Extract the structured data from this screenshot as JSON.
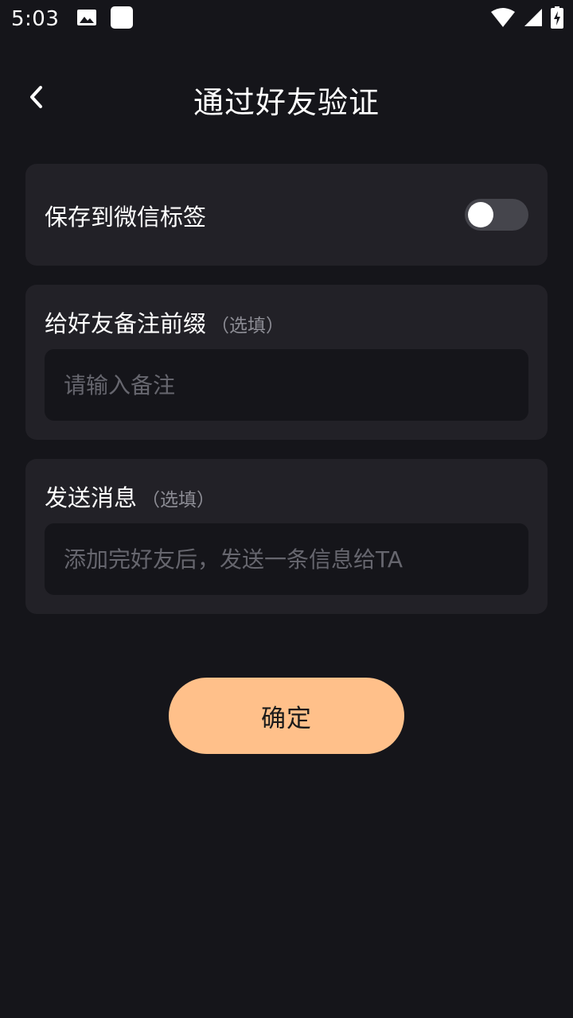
{
  "status_bar": {
    "time": "5:03",
    "icons": [
      "image-icon",
      "app-square-icon",
      "wifi-icon",
      "cell-signal-icon",
      "battery-charging-icon"
    ]
  },
  "nav": {
    "back_icon": "chevron-left-icon",
    "title": "通过好友验证"
  },
  "save_tag": {
    "label": "保存到微信标签",
    "enabled": false
  },
  "remark": {
    "label": "给好友备注前缀",
    "optional": "（选填）",
    "placeholder": "请输入备注",
    "value": ""
  },
  "message": {
    "label": "发送消息",
    "optional": "（选填）",
    "placeholder": "添加完好友后，发送一条信息给TA",
    "value": ""
  },
  "confirm": {
    "label": "确定"
  },
  "colors": {
    "background": "#15151a",
    "card": "#222127",
    "accent": "#ffc08a",
    "switch_off": "#45454c"
  }
}
